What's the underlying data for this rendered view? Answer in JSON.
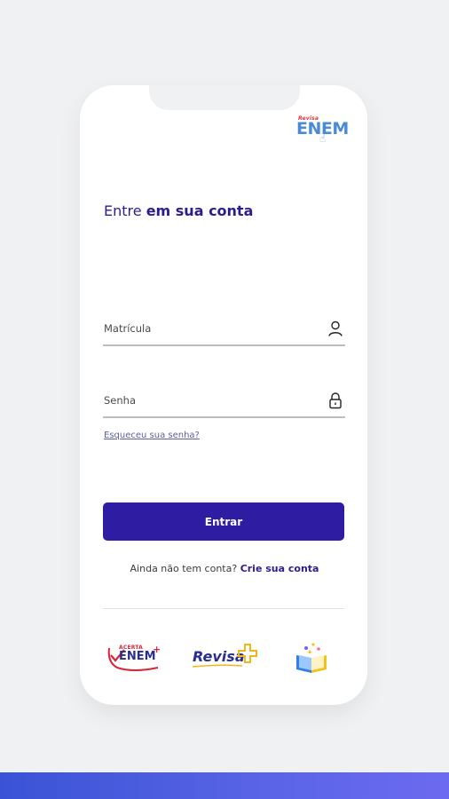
{
  "brand": {
    "top_text": "Revisa",
    "main_text": "ENEM"
  },
  "login": {
    "title_regular": "Entre ",
    "title_bold": "em sua conta",
    "registration_label": "Matrícula",
    "password_label": "Senha",
    "forgot_password": "Esqueceu sua senha?",
    "submit_label": "Entrar",
    "signup_prompt": "Ainda não tem conta?",
    "signup_link": "Crie sua conta"
  },
  "partners": {
    "logo1_tag": "ACERTA",
    "logo1_word": "ENEM",
    "logo2_word": "Revisa"
  },
  "colors": {
    "primary": "#2e1ca3",
    "title": "#2a1f8a",
    "bottom_bar_start": "#3a53d6",
    "bottom_bar_end": "#6c6af0"
  }
}
